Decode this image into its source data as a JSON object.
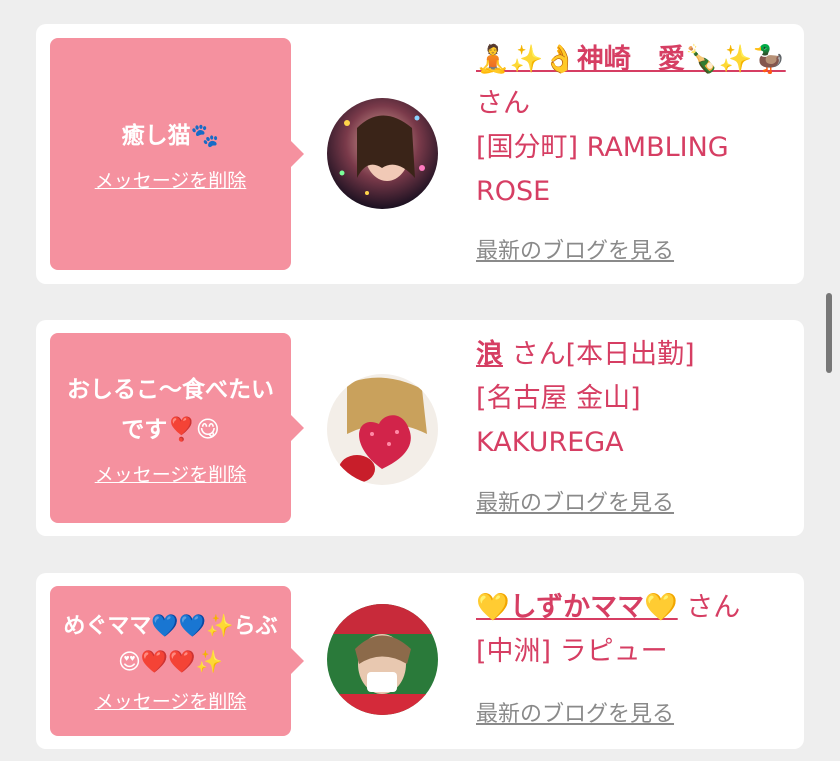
{
  "cards": [
    {
      "message": "癒し猫🐾",
      "delete_label": "メッセージを削除",
      "name": "🧘✨👌神崎　愛🍾✨🦆",
      "suffix": "さん",
      "shop": "[国分町] RAMBLING ROSE",
      "blog_label": "最新のブログを見る"
    },
    {
      "message": "おしるこ〜食べたいです❣️😋",
      "delete_label": "メッセージを削除",
      "name": "浪",
      "suffix": "さん[本日出勤]",
      "shop": "[名古屋 金山] KAKUREGA",
      "blog_label": "最新のブログを見る"
    },
    {
      "message": "めぐママ💙💙✨らぶ😍❤️❤️✨",
      "delete_label": "メッセージを削除",
      "name": "💛しずかママ💛",
      "suffix": "さん",
      "shop": "[中洲] ラピュー",
      "blog_label": "最新のブログを見る"
    }
  ],
  "colors": {
    "bubble": "#f5919f",
    "accent": "#d63e63",
    "link_gray": "#8a8a8a",
    "background": "#eeeeee"
  }
}
